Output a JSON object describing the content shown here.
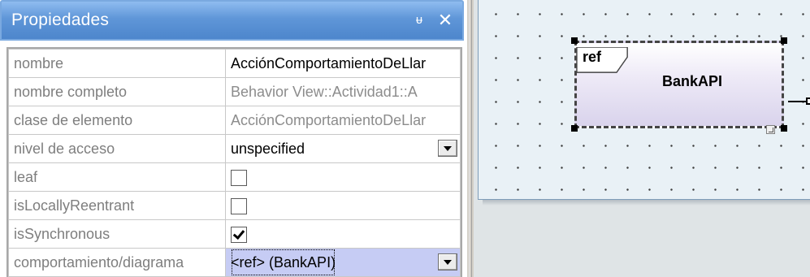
{
  "panel": {
    "title": "Propiedades",
    "pin_icon": "pin-icon",
    "close_icon": "close-icon",
    "pin_glyph": "ᵾ",
    "close_glyph": "✕",
    "rows": [
      {
        "name": "nombre",
        "value": "AcciónComportamientoDeLlar",
        "type": "text"
      },
      {
        "name": "nombre completo",
        "value": "Behavior View::Actividad1::A",
        "type": "readonly"
      },
      {
        "name": "clase de elemento",
        "value": "AcciónComportamientoDeLlar",
        "type": "readonly"
      },
      {
        "name": "nivel de acceso",
        "value": "unspecified",
        "type": "combo"
      },
      {
        "name": "leaf",
        "checked": false,
        "type": "check"
      },
      {
        "name": "isLocallyReentrant",
        "checked": false,
        "type": "check"
      },
      {
        "name": "isSynchronous",
        "checked": true,
        "type": "check"
      },
      {
        "name": "comportamiento/diagrama",
        "value": "<ref> (BankAPI)",
        "type": "combo",
        "selected": true
      }
    ]
  },
  "diagram": {
    "node_tag": "ref",
    "node_name": "BankAPI"
  },
  "colors": {
    "header_blue": "#5f96d8",
    "selection": "#c6ccf4",
    "canvas": "#e9f1f6"
  }
}
